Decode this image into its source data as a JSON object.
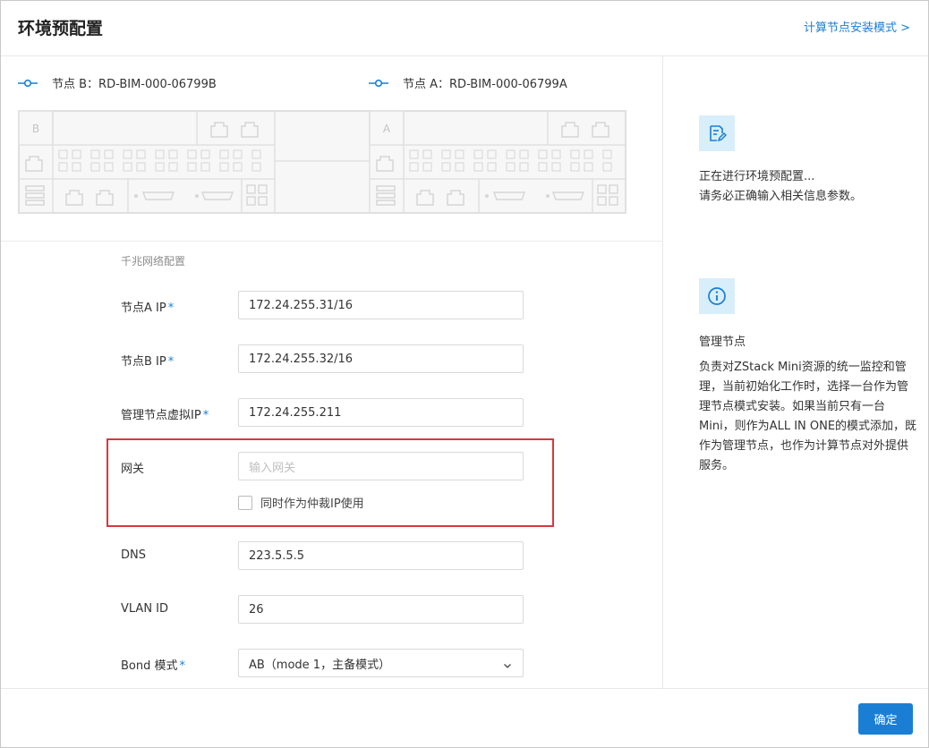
{
  "header": {
    "title": "环境预配置",
    "link": "计算节点安装模式 >"
  },
  "nodes": {
    "b": {
      "label": "节点 B：RD-BIM-000-06799B",
      "badge": "B"
    },
    "a": {
      "label": "节点 A：RD-BIM-000-06799A",
      "badge": "A"
    }
  },
  "form": {
    "section_title": "千兆网络配置",
    "node_a_ip": {
      "label": "节点A IP",
      "value": "172.24.255.31/16"
    },
    "node_b_ip": {
      "label": "节点B IP",
      "value": "172.24.255.32/16"
    },
    "mgmt_vip": {
      "label": "管理节点虚拟IP",
      "value": "172.24.255.211"
    },
    "gateway": {
      "label": "网关",
      "value": "",
      "placeholder": "输入网关",
      "checkbox_label": "同时作为仲裁IP使用"
    },
    "dns": {
      "label": "DNS",
      "value": "223.5.5.5"
    },
    "vlan": {
      "label": "VLAN ID",
      "value": "26"
    },
    "bond": {
      "label": "Bond 模式",
      "value": "AB（mode 1，主备模式）"
    },
    "required_mark": "*"
  },
  "side": {
    "status_line1": "正在进行环境预配置...",
    "status_line2": "请务必正确输入相关信息参数。",
    "mgmt_title": "管理节点",
    "mgmt_desc": "负责对ZStack Mini资源的统一监控和管理，当前初始化工作时，选择一台作为管理节点模式安装。如果当前只有一台Mini，则作为ALL IN ONE的模式添加，既作为管理节点，也作为计算节点对外提供服务。"
  },
  "footer": {
    "confirm": "确定"
  },
  "colors": {
    "accent": "#1a7fd4",
    "highlight": "#d9363e",
    "tile": "#d8eefb"
  }
}
